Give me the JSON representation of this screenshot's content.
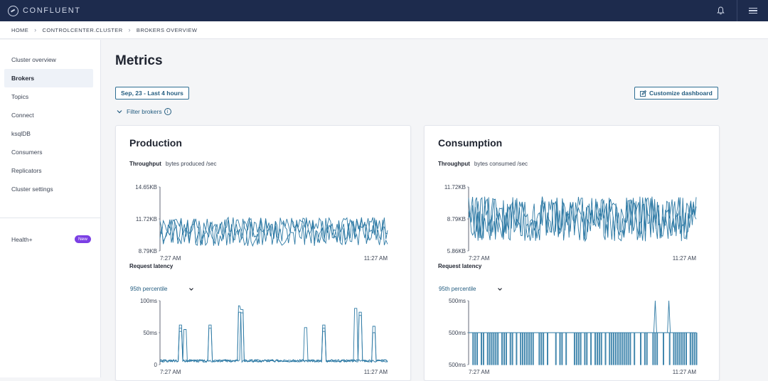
{
  "app": {
    "brand": "CONFLUENT"
  },
  "colors": {
    "topbar": "#1d2b4d",
    "accent": "#245d80",
    "line": "#2e7aa5",
    "badge": "#7b3fe4"
  },
  "header_icons": [
    "bell-icon",
    "hamburger-menu-icon"
  ],
  "breadcrumb": [
    "HOME",
    "CONTROLCENTER.CLUSTER",
    "BROKERS OVERVIEW"
  ],
  "sidebar": {
    "items": [
      {
        "label": "Cluster overview"
      },
      {
        "label": "Brokers",
        "active": true
      },
      {
        "label": "Topics"
      },
      {
        "label": "Connect"
      },
      {
        "label": "ksqlDB"
      },
      {
        "label": "Consumers"
      },
      {
        "label": "Replicators"
      },
      {
        "label": "Cluster settings"
      }
    ],
    "health_label": "Health+",
    "health_badge": "New"
  },
  "main": {
    "title": "Metrics",
    "date_range": "Sep, 23 - Last 4 hours",
    "customize_label": "Customize dashboard",
    "filter_label": "Filter brokers"
  },
  "cards": [
    {
      "title": "Production",
      "throughput_label": "Throughput",
      "throughput_sub": "bytes produced /sec",
      "latency_label": "Request latency",
      "percentile": "95th percentile"
    },
    {
      "title": "Consumption",
      "throughput_label": "Throughput",
      "throughput_sub": "bytes consumed /sec",
      "latency_label": "Request latency",
      "percentile": "95th percentile"
    }
  ],
  "chart_data": [
    {
      "type": "line",
      "title": "Production Throughput",
      "ylabel": "bytes produced /sec",
      "y_ticks": [
        "14.65KB",
        "11.72KB",
        "8.79KB"
      ],
      "x_ticks": [
        "7:27 AM",
        "11:27 AM"
      ],
      "ylim": [
        8.79,
        14.65
      ],
      "y_unit": "KB",
      "series_count": 3
    },
    {
      "type": "line",
      "title": "Production Request latency",
      "y_ticks": [
        "100ms",
        "50ms",
        "0"
      ],
      "x_ticks": [
        "7:27 AM",
        "11:27 AM"
      ],
      "ylim": [
        0,
        100
      ],
      "y_unit": "ms",
      "series_count": 3
    },
    {
      "type": "line",
      "title": "Consumption Throughput",
      "ylabel": "bytes consumed /sec",
      "y_ticks": [
        "11.72KB",
        "8.79KB",
        "5.86KB"
      ],
      "x_ticks": [
        "7:27 AM",
        "11:27 AM"
      ],
      "ylim": [
        5.86,
        11.72
      ],
      "y_unit": "KB",
      "series_count": 3
    },
    {
      "type": "line",
      "title": "Consumption Request latency",
      "y_ticks": [
        "500ms",
        "500ms",
        "500ms"
      ],
      "x_ticks": [
        "7:27 AM",
        "11:27 AM"
      ],
      "series_count": 1
    }
  ]
}
